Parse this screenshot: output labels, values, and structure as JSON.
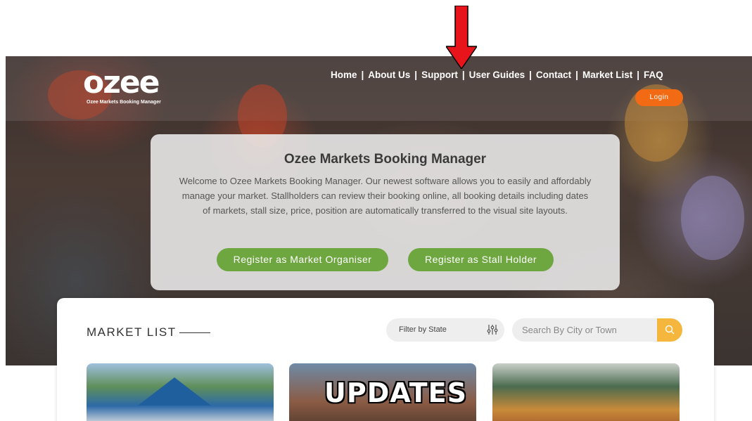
{
  "brand": {
    "logo_text": "ozee",
    "tagline": "Ozee Markets Booking Manager"
  },
  "nav": {
    "items": [
      "Home",
      "About Us",
      "Support",
      "User Guides",
      "Contact",
      "Market List",
      "FAQ"
    ],
    "separator": "|",
    "login_label": "Login"
  },
  "hero": {
    "title": "Ozee Markets Booking Manager",
    "description": "Welcome to Ozee Markets Booking Manager. Our newest software allows you to easily and affordably manage your market. Stallholders can review their booking online, all booking details including dates of markets, stall size, price, position are automatically transferred to the visual site layouts.",
    "btn_organiser": "Register as Market Organiser",
    "btn_stallholder": "Register as Stall Holder"
  },
  "market_list": {
    "heading": "MARKET LIST",
    "filter_label": "Filter by State",
    "search_placeholder": "Search By City or Town",
    "cards": [
      {
        "image": "market-tent-photo"
      },
      {
        "image": "updates-banner",
        "overlay_text": "UPDATES"
      },
      {
        "image": "produce-stall-photo"
      }
    ]
  },
  "colors": {
    "login": "#f26a14",
    "green_button": "#6ea640",
    "search_button": "#f4b63c",
    "annotation_arrow": "#e8141c"
  }
}
